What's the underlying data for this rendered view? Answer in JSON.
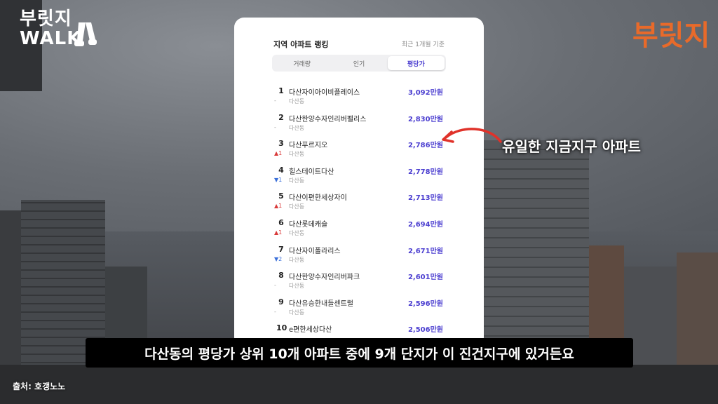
{
  "logo_left": {
    "line1": "부릿지",
    "line2": "WALK"
  },
  "logo_right": "부릿지",
  "card": {
    "title": "지역 아파트 랭킹",
    "subtitle": "최근 1개월 기준",
    "tabs": [
      {
        "label": "거래량",
        "active": false
      },
      {
        "label": "인기",
        "active": false
      },
      {
        "label": "평당가",
        "active": true
      }
    ],
    "rows": [
      {
        "rank": "1",
        "name": "다산자이아이비플레이스",
        "district": "다산동",
        "change": "-",
        "change_dir": "none",
        "price": "3,092만원"
      },
      {
        "rank": "2",
        "name": "다산한양수자인리버펠리스",
        "district": "다산동",
        "change": "-",
        "change_dir": "none",
        "price": "2,830만원"
      },
      {
        "rank": "3",
        "name": "다산푸르지오",
        "district": "다산동",
        "change": "▲1",
        "change_dir": "up",
        "price": "2,786만원"
      },
      {
        "rank": "4",
        "name": "힐스테이트다산",
        "district": "다산동",
        "change": "▼1",
        "change_dir": "down",
        "price": "2,778만원"
      },
      {
        "rank": "5",
        "name": "다산이편한세상자이",
        "district": "다산동",
        "change": "▲1",
        "change_dir": "up",
        "price": "2,713만원"
      },
      {
        "rank": "6",
        "name": "다산롯데캐슬",
        "district": "다산동",
        "change": "▲1",
        "change_dir": "up",
        "price": "2,694만원"
      },
      {
        "rank": "7",
        "name": "다산자이폴라리스",
        "district": "다산동",
        "change": "▼2",
        "change_dir": "down",
        "price": "2,671만원"
      },
      {
        "rank": "8",
        "name": "다산한양수자인리버파크",
        "district": "다산동",
        "change": "-",
        "change_dir": "none",
        "price": "2,601만원"
      },
      {
        "rank": "9",
        "name": "다산유승한내들센트럴",
        "district": "다산동",
        "change": "-",
        "change_dir": "none",
        "price": "2,596만원"
      },
      {
        "rank": "10",
        "name": "e편한세상다산",
        "district": "",
        "change": "",
        "change_dir": "none",
        "price": "2,506만원"
      }
    ]
  },
  "annotation": "유일한 지금지구 아파트",
  "subtitle": "다산동의 평당가 상위 10개 아파트 중에 9개 단지가 이 진건지구에 있거든요",
  "source": "출처: 호갱노노",
  "colors": {
    "accent": "#4b3ed0",
    "up": "#d93a3a",
    "down": "#3a6fd9",
    "arrow": "#e0322a",
    "brand": "#e86a2a"
  }
}
